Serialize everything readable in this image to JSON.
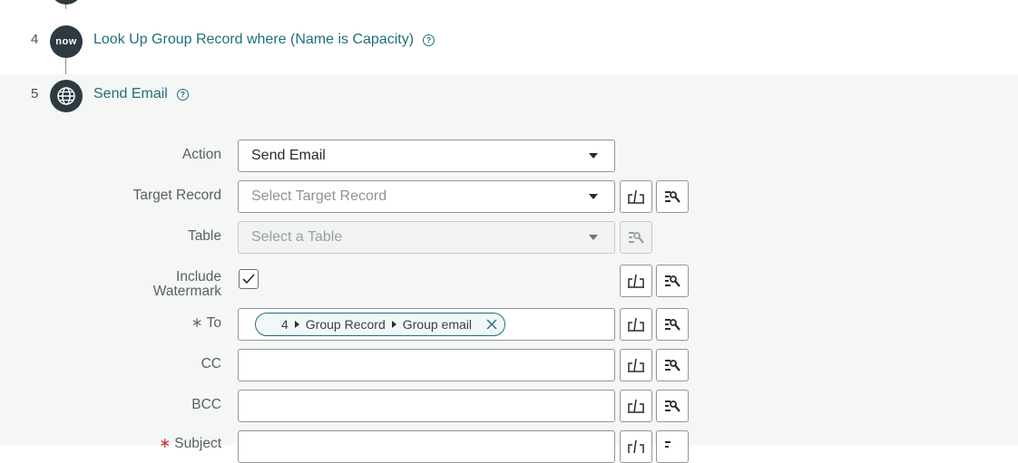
{
  "steps": [
    {
      "number": "4",
      "icon": "servicenow-now-icon",
      "icon_text": "now",
      "title": "Look Up Group Record where (Name is Capacity)",
      "help": "?"
    },
    {
      "number": "5",
      "icon": "globe-icon",
      "title": "Send Email",
      "help": "?"
    }
  ],
  "form": {
    "action": {
      "label": "Action",
      "value": "Send Email"
    },
    "target_record": {
      "label": "Target Record",
      "placeholder": "Select Target Record"
    },
    "table": {
      "label": "Table",
      "placeholder": "Select a Table"
    },
    "include_watermark": {
      "label_line1": "Include",
      "label_line2": "Watermark",
      "checked": true
    },
    "to": {
      "required_mark": "∗",
      "label": "To",
      "pill": {
        "step": "4",
        "record": "Group Record",
        "field": "Group email"
      }
    },
    "cc": {
      "label": "CC",
      "value": ""
    },
    "bcc": {
      "label": "BCC",
      "value": ""
    },
    "subject": {
      "required_mark": "∗",
      "label": "Subject"
    }
  },
  "colors": {
    "accent_teal": "#1f6f7a",
    "step_circle": "#2f3a40",
    "panel_bg": "#f5f7f6",
    "required_red": "#c8352d"
  }
}
